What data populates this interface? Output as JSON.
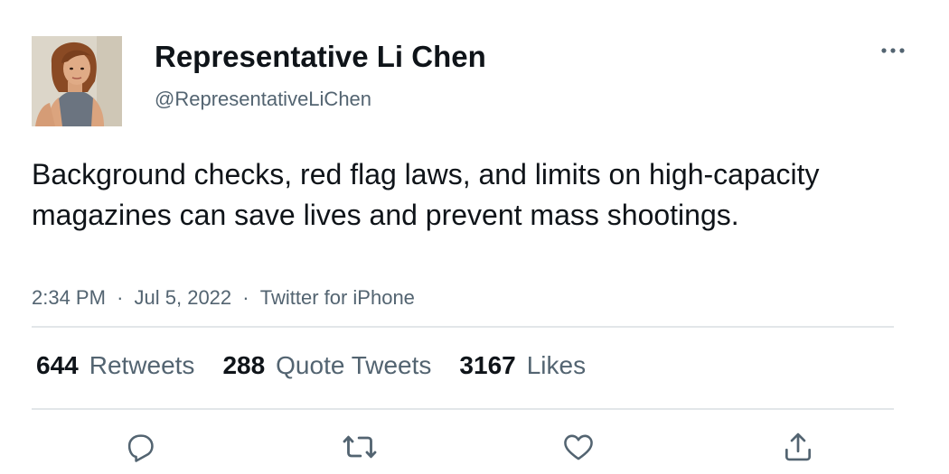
{
  "author": {
    "display_name": "Representative Li Chen",
    "handle": "@RepresentativeLiChen"
  },
  "tweet": {
    "text": "Background checks, red flag laws, and limits on high-capacity magazines can save lives and prevent mass shootings.",
    "time": "2:34 PM",
    "separator": "·",
    "date": "Jul 5, 2022",
    "source": "Twitter for iPhone"
  },
  "stats": {
    "retweets_count": "644",
    "retweets_label": "Retweets",
    "quotes_count": "288",
    "quotes_label": "Quote Tweets",
    "likes_count": "3167",
    "likes_label": "Likes"
  },
  "actions": [
    "reply-icon",
    "retweet-icon",
    "like-icon",
    "share-icon"
  ],
  "colors": {
    "text_primary": "#0f1419",
    "text_secondary": "#536471",
    "divider": "#e2e6e9",
    "icon": "#536471"
  }
}
